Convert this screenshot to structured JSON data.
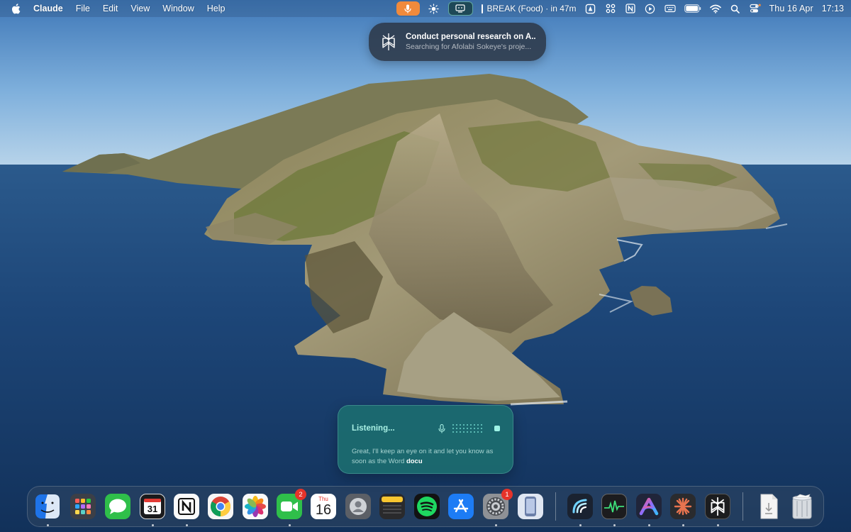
{
  "menubar": {
    "app_name": "Claude",
    "menus": [
      "File",
      "Edit",
      "View",
      "Window",
      "Help"
    ],
    "break_status": "BREAK (Food) · in 47m",
    "date": "Thu 16 Apr",
    "time": "17:13",
    "icons": [
      "apple-icon",
      "microphone-icon",
      "sun-icon",
      "screen-icon",
      "onepassword-icon",
      "grid-icon",
      "notion-icon",
      "play-icon",
      "keyboard-icon",
      "battery-icon",
      "wifi-icon",
      "search-icon",
      "control-center-icon"
    ]
  },
  "task_notification": {
    "title": "Conduct personal research on A...",
    "subtitle": "Searching for Afolabi Sokeye's proje..."
  },
  "listening": {
    "title": "Listening...",
    "message": "Great, I'll keep an eye on it and let you know as soon as the Word",
    "message_partial": "docu"
  },
  "dock": {
    "items": [
      {
        "name": "finder-icon",
        "running": true
      },
      {
        "name": "launchpad-icon",
        "running": false
      },
      {
        "name": "messages-icon",
        "running": false
      },
      {
        "name": "fantastical-icon",
        "running": true
      },
      {
        "name": "notion-icon",
        "running": true
      },
      {
        "name": "chrome-icon",
        "running": false
      },
      {
        "name": "photos-icon",
        "running": false
      },
      {
        "name": "facetime-icon",
        "running": true,
        "badge": "2"
      },
      {
        "name": "calendar-icon",
        "running": false,
        "day_label": "Thu",
        "day_number": "16"
      },
      {
        "name": "contacts-icon",
        "running": false
      },
      {
        "name": "notes-icon",
        "running": false
      },
      {
        "name": "spotify-icon",
        "running": false
      },
      {
        "name": "app-store-icon",
        "running": false
      },
      {
        "name": "system-settings-icon",
        "running": true,
        "badge": "1"
      },
      {
        "name": "simulator-icon",
        "running": false
      },
      {
        "name": "wave-app-icon",
        "running": true
      },
      {
        "name": "activity-monitor-icon",
        "running": true
      },
      {
        "name": "arc-app-icon",
        "running": true
      },
      {
        "name": "claude-icon",
        "running": true
      },
      {
        "name": "perplexity-icon",
        "running": true
      },
      {
        "name": "downloads-stack-icon",
        "running": false
      },
      {
        "name": "trash-icon",
        "running": false
      }
    ]
  },
  "colors": {
    "mic_accent": "#f08a3c",
    "listening_panel": "#1c7070",
    "listening_title": "#a9f0e4",
    "badge_red": "#e5332a"
  }
}
